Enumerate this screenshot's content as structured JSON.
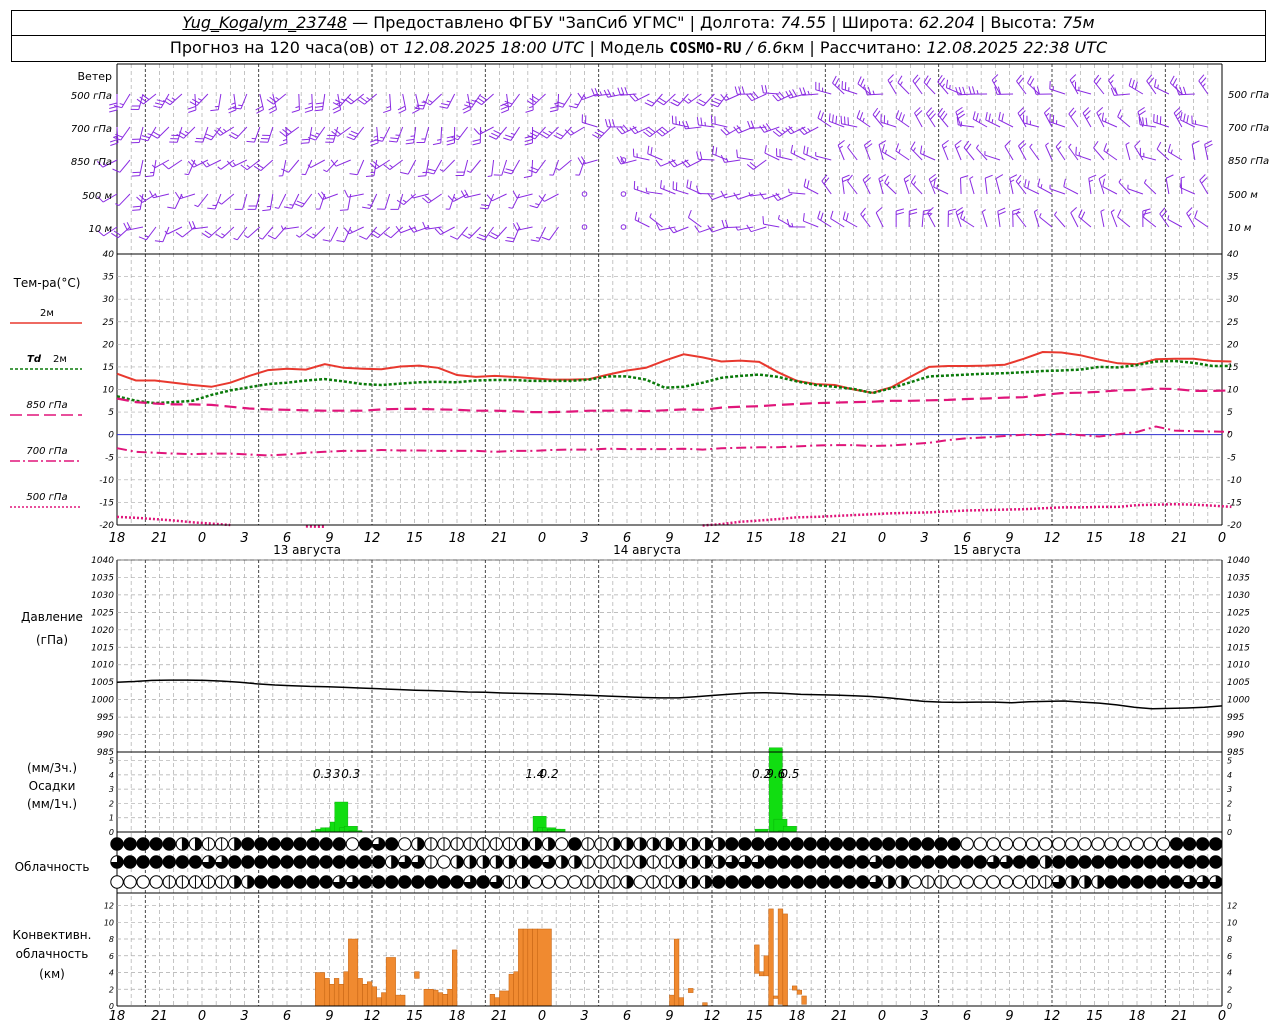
{
  "header": {
    "station": "Yug_Kogalym_23748",
    "provider": " — Предоставлено ФГБУ \"ЗапСиб УГМС\" | Долгота: ",
    "lon": "74.55",
    "lat_label": " | Широта: ",
    "lat": "62.204",
    "alt_label": " | Высота: ",
    "alt": "75м",
    "forecast_prefix": "Прогноз на 120 часа(ов) от ",
    "forecast_start": "12.08.2025 18:00 UTC",
    "model_prefix": "  | Модель ",
    "model": "COSMO-RU",
    "model_res_sep": " / ",
    "model_res": "6.6",
    "model_res_unit": "км",
    "calc_prefix": " | Рассчитано: ",
    "calc_time": "12.08.2025 22:38 UTC"
  },
  "wind_panel": {
    "title": "Ветер",
    "levels": [
      "500 гПа",
      "700 гПа",
      "850 гПа",
      "500 м",
      "10 м"
    ],
    "color": "#8a2be2"
  },
  "temp_legend": {
    "title": "Тем-ра(°С)",
    "t2m": "2м",
    "td_symbol": "Td",
    "td2m": "2м",
    "t850": "850 гПа",
    "t700": "700 гПа",
    "t500": "500 гПа"
  },
  "pressure_legend": {
    "title": "Давление",
    "unit": "(гПа)"
  },
  "precip_legend": {
    "unit3": "(мм/3ч.)",
    "title": "Осадки",
    "unit1": "(мм/1ч.)"
  },
  "cloud_legend": {
    "title": "Облачность"
  },
  "conv_legend": {
    "line1": "Конвективн.",
    "line2": "облачность",
    "line3": "(км)"
  },
  "time_axis": {
    "hour_labels": [
      "18",
      "21",
      "0",
      "3",
      "6",
      "9",
      "12",
      "15",
      "18",
      "21",
      "0",
      "3",
      "6",
      "9",
      "12",
      "15",
      "18",
      "21",
      "0",
      "3",
      "6",
      "9",
      "12",
      "15",
      "18",
      "21",
      "0"
    ],
    "date_labels": [
      "13 августа",
      "14 августа",
      "15 августа"
    ]
  },
  "colors": {
    "t2m": "#e8382e",
    "td2m": "#0a7a0a",
    "tlev": "#e0157a",
    "pressure": "#000000",
    "precip": "#11dd11",
    "conv": "#f08a30",
    "zero_line": "#3030d0"
  },
  "chart_data": [
    {
      "type": "line",
      "title": "Тем-ра(°С)",
      "x": [
        0,
        3,
        6,
        9,
        12,
        15,
        18,
        21,
        24,
        27,
        30,
        33,
        36,
        39,
        42,
        45,
        48,
        51,
        54,
        57,
        60,
        63,
        66,
        69,
        72,
        75,
        78,
        81,
        84,
        87,
        90,
        93,
        96,
        99,
        102,
        105,
        108,
        111,
        114,
        117,
        120,
        123,
        126,
        129,
        132,
        135,
        138,
        141,
        144,
        147,
        150,
        153,
        156,
        159,
        162,
        165,
        168,
        171,
        174,
        177,
        180,
        183,
        186,
        189,
        192,
        195,
        198,
        201,
        204,
        207,
        210,
        213,
        216,
        219,
        222,
        225,
        228,
        231,
        234
      ],
      "ylim": [
        -20,
        40
      ],
      "yticks": [
        -20,
        -15,
        -10,
        -5,
        0,
        5,
        10,
        15,
        20,
        25,
        30,
        35,
        40
      ],
      "series": [
        {
          "name": "2м",
          "values": [
            13.5,
            12,
            12,
            11.5,
            11,
            10.6,
            11.5,
            13,
            14.3,
            14.6,
            14.4,
            15.6,
            14.8,
            14.6,
            14.5,
            15.1,
            15.3,
            14.8,
            13.2,
            12.8,
            13,
            12.8,
            12.5,
            12.2,
            12.2,
            12.3,
            13.3,
            14.2,
            14.8,
            16.4,
            17.8,
            17.1,
            16.2,
            16.4,
            16.1,
            13.8,
            11.9,
            11.2,
            11,
            10,
            9.3,
            10.5,
            12.8,
            15,
            15.2,
            15.2,
            15.3,
            15.5,
            16.8,
            18.3,
            18.2,
            17.6,
            16.6,
            15.8,
            15.6,
            16.7,
            16.8,
            16.8,
            16.3,
            16.2
          ]
        },
        {
          "name": "Td 2м",
          "values": [
            8.5,
            7.5,
            7,
            7.2,
            7.5,
            8.8,
            9.8,
            10.5,
            11.2,
            11.5,
            12,
            12.3,
            11.8,
            11.2,
            11,
            11.3,
            11.6,
            11.7,
            11.6,
            12,
            12.1,
            12.1,
            11.9,
            11.9,
            11.9,
            12.2,
            12.9,
            12.9,
            12.2,
            10.4,
            10.6,
            11.5,
            12.6,
            13,
            13.3,
            12.8,
            11.8,
            11,
            10.6,
            10.1,
            9.2,
            10.3,
            11.6,
            12.9,
            13.1,
            13.3,
            13.5,
            13.6,
            13.8,
            14.1,
            14.2,
            14.4,
            15,
            14.9,
            15.4,
            16.2,
            16.3,
            15.9,
            15.2,
            15.2
          ]
        },
        {
          "name": "850 гПа",
          "values": [
            8,
            7.2,
            6.9,
            6.7,
            6.7,
            6.6,
            6.2,
            5.8,
            5.6,
            5.5,
            5.4,
            5.3,
            5.3,
            5.3,
            5.6,
            5.7,
            5.7,
            5.6,
            5.5,
            5.3,
            5.3,
            5.2,
            5,
            5,
            5.1,
            5.3,
            5.3,
            5.4,
            5.2,
            5.4,
            5.6,
            5.5,
            6,
            6.2,
            6.3,
            6.6,
            6.8,
            7,
            7.1,
            7.2,
            7.3,
            7.5,
            7.5,
            7.6,
            7.7,
            7.9,
            8,
            8.2,
            8.3,
            8.8,
            9.2,
            9.3,
            9.5,
            9.8,
            9.9,
            10.2,
            10.1,
            9.7,
            9.7,
            9.8
          ]
        },
        {
          "name": "700 гПа",
          "values": [
            -3,
            -3.8,
            -4,
            -4.2,
            -4.3,
            -4.2,
            -4.2,
            -4.4,
            -4.6,
            -4.4,
            -4,
            -3.8,
            -3.6,
            -3.6,
            -3.4,
            -3.5,
            -3.5,
            -3.6,
            -3.6,
            -3.6,
            -3.8,
            -3.6,
            -3.6,
            -3.4,
            -3.3,
            -3.3,
            -3.1,
            -3.2,
            -3.2,
            -3.2,
            -3.1,
            -3.3,
            -3,
            -2.9,
            -2.8,
            -2.8,
            -2.6,
            -2.4,
            -2.3,
            -2.3,
            -2.5,
            -2.4,
            -2.1,
            -1.8,
            -1.2,
            -0.8,
            -0.6,
            -0.3,
            0,
            -0.1,
            0.2,
            -0.1,
            -0.4,
            0.1,
            0.6,
            1.8,
            0.9,
            0.8,
            0.7,
            0.6
          ]
        },
        {
          "name": "500 гПа",
          "values": [
            -18.2,
            -18.4,
            -18.7,
            -19,
            -19.4,
            -19.7,
            -20,
            null,
            null,
            null,
            -20.3,
            -20.4,
            null,
            null,
            null,
            null,
            null,
            null,
            null,
            null,
            null,
            null,
            null,
            null,
            null,
            null,
            null,
            null,
            null,
            null,
            null,
            -20.1,
            -19.8,
            -19.3,
            -19,
            -18.7,
            -18.3,
            -18.2,
            -18,
            -17.8,
            -17.6,
            -17.4,
            -17.3,
            -17.2,
            -17,
            -16.8,
            -16.7,
            -16.6,
            -16.5,
            -16.3,
            -16.1,
            -16.1,
            -16,
            -16,
            -15.6,
            -15.5,
            -15.4,
            -15.5,
            -15.7,
            -16
          ]
        }
      ]
    },
    {
      "type": "line",
      "title": "Давление",
      "ylabel": "(гПа)",
      "ylim": [
        985,
        1040
      ],
      "yticks": [
        985,
        990,
        995,
        1000,
        1005,
        1010,
        1015,
        1020,
        1025,
        1030,
        1035,
        1040
      ],
      "series": [
        {
          "name": "Давление",
          "values": [
            1005,
            1005.2,
            1005.5,
            1005.6,
            1005.6,
            1005.5,
            1005.3,
            1005,
            1004.5,
            1004.2,
            1004,
            1003.8,
            1003.7,
            1003.5,
            1003.3,
            1003.1,
            1002.9,
            1002.7,
            1002.6,
            1002.4,
            1002.2,
            1002.1,
            1001.9,
            1001.8,
            1001.7,
            1001.6,
            1001.4,
            1001.2,
            1001,
            1000.8,
            1000.6,
            1000.5,
            1000.5,
            1000.8,
            1001.2,
            1001.6,
            1001.9,
            1002,
            1001.8,
            1001.5,
            1001.4,
            1001.3,
            1001.1,
            1000.9,
            1000.5,
            1000,
            999.5,
            999.3,
            999.2,
            999.3,
            999.3,
            999.1,
            999.4,
            999.5,
            999.6,
            999.3,
            999,
            998.5,
            997.8,
            997.4,
            997.5,
            997.6,
            997.8,
            998.2
          ]
        }
      ]
    },
    {
      "type": "bar",
      "title": "Осадки",
      "ylabel": "(мм/1ч.)",
      "ylim": [
        0,
        5.6
      ],
      "yticks": [
        0,
        1,
        2,
        3,
        4,
        5
      ],
      "bars": [
        {
          "h": 41,
          "v": 0.1
        },
        {
          "h": 42,
          "v": 0.2
        },
        {
          "h": 43,
          "v": 0.3
        },
        {
          "h": 44,
          "v": 0.3
        },
        {
          "h": 45,
          "v": 0.7
        },
        {
          "h": 46,
          "v": 2.1
        },
        {
          "h": 47,
          "v": 0.3
        },
        {
          "h": 48,
          "v": 0.4
        },
        {
          "h": 49,
          "v": 0.1
        },
        {
          "h": 88,
          "v": 1.1
        },
        {
          "h": 89,
          "v": 0.3
        },
        {
          "h": 90,
          "v": 0.3
        },
        {
          "h": 91,
          "v": 0.2
        },
        {
          "h": 92,
          "v": 0.2
        },
        {
          "h": 135,
          "v": 0.2
        },
        {
          "h": 138,
          "v": 5.9
        },
        {
          "h": 139,
          "v": 0.9
        },
        {
          "h": 140,
          "v": 0.1
        },
        {
          "h": 141,
          "v": 0.4
        }
      ],
      "totals_3h": [
        {
          "h": 43.5,
          "label": "0.3"
        },
        {
          "h": 46.5,
          "label": "3"
        },
        {
          "h": 49.5,
          "label": "0.3"
        },
        {
          "h": 88.5,
          "label": "1.4"
        },
        {
          "h": 91.5,
          "label": "0.2"
        },
        {
          "h": 136.5,
          "label": "0.2"
        },
        {
          "h": 139.5,
          "label": "9.6"
        },
        {
          "h": 142.5,
          "label": "0.5"
        }
      ]
    },
    {
      "type": "bar",
      "title": "Конвективн. облачность",
      "ylabel": "(км)",
      "ylim": [
        0,
        13.5
      ],
      "yticks": [
        0,
        2,
        4,
        6,
        8,
        10,
        12
      ],
      "bars": [
        {
          "h0": 42,
          "h1": 44,
          "bot": 0,
          "top": 4
        },
        {
          "h0": 44,
          "h1": 45,
          "bot": 0,
          "top": 3.3
        },
        {
          "h0": 45,
          "h1": 46,
          "bot": 0,
          "top": 2.6
        },
        {
          "h0": 46,
          "h1": 47,
          "bot": 0,
          "top": 3.3
        },
        {
          "h0": 47,
          "h1": 48,
          "bot": 0,
          "top": 2.6
        },
        {
          "h0": 48,
          "h1": 49,
          "bot": 0,
          "top": 4.1
        },
        {
          "h0": 49,
          "h1": 51,
          "bot": 0,
          "top": 8
        },
        {
          "h0": 51,
          "h1": 52,
          "bot": 0,
          "top": 3.3
        },
        {
          "h0": 52,
          "h1": 53,
          "bot": 0,
          "top": 2.6
        },
        {
          "h0": 53,
          "h1": 54,
          "bot": 0,
          "top": 2.9
        },
        {
          "h0": 54,
          "h1": 55,
          "bot": 0,
          "top": 2.3
        },
        {
          "h0": 55,
          "h1": 56,
          "bot": 0,
          "top": 1
        },
        {
          "h0": 56,
          "h1": 57,
          "bot": 0,
          "top": 1.6
        },
        {
          "h0": 57,
          "h1": 59,
          "bot": 0,
          "top": 5.8
        },
        {
          "h0": 59,
          "h1": 61,
          "bot": 0,
          "top": 1.3
        },
        {
          "h0": 63,
          "h1": 64,
          "bot": 3.3,
          "top": 4.1
        },
        {
          "h0": 65,
          "h1": 67,
          "bot": 0,
          "top": 2
        },
        {
          "h0": 67,
          "h1": 68,
          "bot": 0,
          "top": 1.9
        },
        {
          "h0": 68,
          "h1": 69,
          "bot": 0,
          "top": 1.6
        },
        {
          "h0": 69,
          "h1": 70,
          "bot": 0,
          "top": 1.4
        },
        {
          "h0": 70,
          "h1": 71,
          "bot": 0,
          "top": 2
        },
        {
          "h0": 71,
          "h1": 72,
          "bot": 0,
          "top": 6.7
        },
        {
          "h0": 79,
          "h1": 80,
          "bot": 0,
          "top": 1.4
        },
        {
          "h0": 80,
          "h1": 81,
          "bot": 0,
          "top": 1
        },
        {
          "h0": 81,
          "h1": 83,
          "bot": 0,
          "top": 1.8
        },
        {
          "h0": 83,
          "h1": 84,
          "bot": 0,
          "top": 3.8
        },
        {
          "h0": 84,
          "h1": 85,
          "bot": 0,
          "top": 4.1
        },
        {
          "h0": 85,
          "h1": 86,
          "bot": 0,
          "top": 9.2
        },
        {
          "h0": 86,
          "h1": 87,
          "bot": 0,
          "top": 9.2
        },
        {
          "h0": 87,
          "h1": 88,
          "bot": 0,
          "top": 9.2
        },
        {
          "h0": 88,
          "h1": 89,
          "bot": 0,
          "top": 9.2
        },
        {
          "h0": 89,
          "h1": 92,
          "bot": 0,
          "top": 9.2
        },
        {
          "h0": 117,
          "h1": 118,
          "bot": 0,
          "top": 1.3
        },
        {
          "h0": 118,
          "h1": 119,
          "bot": 0,
          "top": 8
        },
        {
          "h0": 119,
          "h1": 120,
          "bot": 0,
          "top": 1
        },
        {
          "h0": 121,
          "h1": 122,
          "bot": 1.6,
          "top": 2.1
        },
        {
          "h0": 124,
          "h1": 125,
          "bot": 0,
          "top": 0.4
        },
        {
          "h0": 135,
          "h1": 136,
          "bot": 3.9,
          "top": 7.3
        },
        {
          "h0": 136,
          "h1": 137,
          "bot": 3.6,
          "top": 4.1
        },
        {
          "h0": 137,
          "h1": 138,
          "bot": 3.6,
          "top": 6
        },
        {
          "h0": 138,
          "h1": 139,
          "bot": 0,
          "top": 11.6
        },
        {
          "h0": 139,
          "h1": 140,
          "bot": 0.9,
          "top": 1.2
        },
        {
          "h0": 140,
          "h1": 141,
          "bot": 0.2,
          "top": 11.6
        },
        {
          "h0": 141,
          "h1": 142,
          "bot": 0,
          "top": 11
        },
        {
          "h0": 143,
          "h1": 144,
          "bot": 1.9,
          "top": 2.4
        },
        {
          "h0": 144,
          "h1": 145,
          "bot": 1.4,
          "top": 1.9
        },
        {
          "h0": 145,
          "h1": 146,
          "bot": 0.2,
          "top": 1.2
        }
      ]
    }
  ],
  "cloud_rows": {
    "coverage_values_0_to_4": [
      "444442211244444444043402111111122204112222222224444444444444444440000000000000000444444444444",
      "344444433444444444444233102222224322111121122223334444444434444444433442444444444444444444444",
      "000011111224444443344444444343120000111201122244444444444432201100000011322244444433344444444"
    ]
  }
}
